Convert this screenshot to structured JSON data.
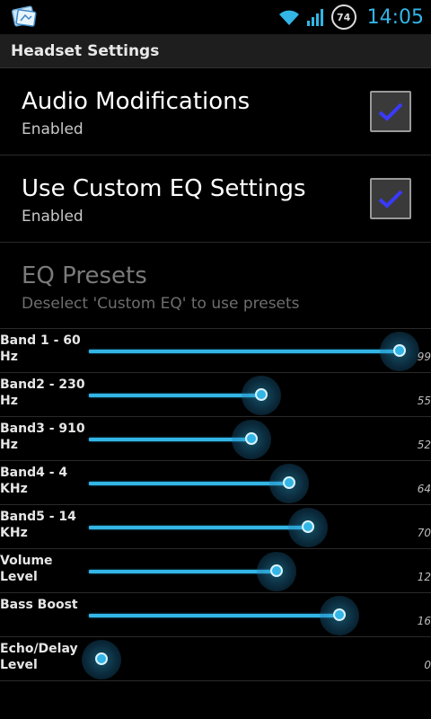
{
  "status_bar": {
    "time": "14:05",
    "battery": "74",
    "icons": [
      "wifi-icon",
      "signal-icon",
      "battery-icon"
    ],
    "accent_color": "#33b5e5"
  },
  "header": {
    "title": "Headset Settings"
  },
  "prefs": {
    "audio_mod": {
      "title": "Audio Modifications",
      "summary": "Enabled",
      "checked": true
    },
    "custom_eq": {
      "title": "Use Custom EQ Settings",
      "summary": "Enabled",
      "checked": true
    },
    "eq_presets": {
      "title": "EQ Presets",
      "summary": "Deselect 'Custom EQ' to use presets",
      "enabled": false
    }
  },
  "sliders": [
    {
      "label": "Band 1 - 60 Hz",
      "value": "99",
      "level": 0.99
    },
    {
      "label": "Band2 - 230 Hz",
      "value": "55",
      "level": 0.55
    },
    {
      "label": "Band3 - 910 Hz",
      "value": "52",
      "level": 0.52
    },
    {
      "label": "Band4 - 4 KHz",
      "value": "64",
      "level": 0.64
    },
    {
      "label": "Band5 - 14 KHz",
      "value": "70",
      "level": 0.7
    },
    {
      "label": "Volume Level",
      "value": "12",
      "level": 0.6
    },
    {
      "label": "Bass Boost",
      "value": "16",
      "level": 0.8
    },
    {
      "label": "Echo/Delay Level",
      "value": "0",
      "level": 0.0
    }
  ]
}
